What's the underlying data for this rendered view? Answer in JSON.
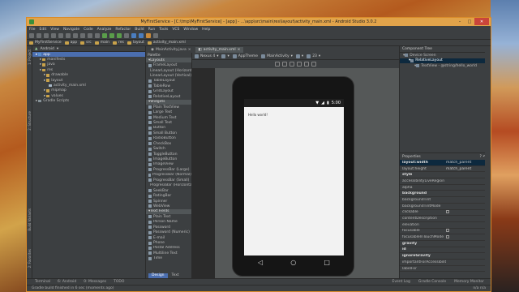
{
  "title": "MyFirstService - [C:\\tmp\\MyFirstService] - [app] - ...\\app\\src\\main\\res\\layout\\activity_main.xml - Android Studio 3.0.2",
  "menu": [
    "File",
    "Edit",
    "View",
    "Navigate",
    "Code",
    "Analyze",
    "Refactor",
    "Build",
    "Run",
    "Tools",
    "VCS",
    "Window",
    "Help"
  ],
  "breadcrumbs": [
    "MyFirstService",
    "app",
    "src",
    "main",
    "res",
    "layout",
    "activity_main.xml"
  ],
  "project": {
    "view": "Android",
    "items": [
      {
        "label": "app",
        "depth": 0,
        "type": "m",
        "sel": true
      },
      {
        "label": "manifests",
        "depth": 1,
        "type": "f"
      },
      {
        "label": "java",
        "depth": 1,
        "type": "f"
      },
      {
        "label": "res",
        "depth": 1,
        "type": "f"
      },
      {
        "label": "drawable",
        "depth": 2,
        "type": "f"
      },
      {
        "label": "layout",
        "depth": 2,
        "type": "f"
      },
      {
        "label": "activity_main.xml",
        "depth": 3,
        "type": "x"
      },
      {
        "label": "mipmap",
        "depth": 2,
        "type": "f"
      },
      {
        "label": "values",
        "depth": 2,
        "type": "f"
      },
      {
        "label": "Gradle Scripts",
        "depth": 0,
        "type": "g"
      }
    ]
  },
  "tabs": [
    {
      "label": "MainActivity.java",
      "active": false
    },
    {
      "label": "activity_main.xml",
      "active": true
    }
  ],
  "palette": {
    "header": "Palette",
    "items": [
      {
        "label": "Layouts",
        "grp": true
      },
      {
        "label": "FrameLayout"
      },
      {
        "label": "LinearLayout (Horizontal)"
      },
      {
        "label": "LinearLayout (Vertical)"
      },
      {
        "label": "TableLayout"
      },
      {
        "label": "TableRow"
      },
      {
        "label": "GridLayout"
      },
      {
        "label": "RelativeLayout"
      },
      {
        "label": "Widgets",
        "grp": true
      },
      {
        "label": "Plain TextView"
      },
      {
        "label": "Large Text"
      },
      {
        "label": "Medium Text"
      },
      {
        "label": "Small Text"
      },
      {
        "label": "Button"
      },
      {
        "label": "Small Button"
      },
      {
        "label": "RadioButton"
      },
      {
        "label": "CheckBox"
      },
      {
        "label": "Switch"
      },
      {
        "label": "ToggleButton"
      },
      {
        "label": "ImageButton"
      },
      {
        "label": "ImageView"
      },
      {
        "label": "ProgressBar (Large)"
      },
      {
        "label": "ProgressBar (Normal)"
      },
      {
        "label": "ProgressBar (Small)"
      },
      {
        "label": "ProgressBar (Horizontal)"
      },
      {
        "label": "SeekBar"
      },
      {
        "label": "RatingBar"
      },
      {
        "label": "Spinner"
      },
      {
        "label": "WebView"
      },
      {
        "label": "Text Fields",
        "grp": true
      },
      {
        "label": "Plain Text"
      },
      {
        "label": "Person Name"
      },
      {
        "label": "Password"
      },
      {
        "label": "Password (Numeric)"
      },
      {
        "label": "E-mail"
      },
      {
        "label": "Phone"
      },
      {
        "label": "Postal Address"
      },
      {
        "label": "Multiline Text"
      },
      {
        "label": "Time"
      }
    ],
    "tabs": [
      "Design",
      "Text"
    ]
  },
  "designbar": [
    "Nexus 4",
    "AppTheme",
    "MainActivity",
    "23"
  ],
  "phone": {
    "time": "5:00",
    "hello": "Hello world!"
  },
  "component_tree": {
    "header": "Component Tree",
    "items": [
      {
        "label": "Device Screen",
        "depth": 0
      },
      {
        "label": "RelativeLayout",
        "depth": 1,
        "sel": true
      },
      {
        "label": "TextView - @string/hello_world",
        "depth": 2
      }
    ]
  },
  "properties": {
    "header": "Properties",
    "rows": [
      {
        "k": "layout:width",
        "v": "match_parent",
        "b": true,
        "sel": true
      },
      {
        "k": "layout:height",
        "v": "match_parent"
      },
      {
        "k": "style",
        "v": "",
        "b": true
      },
      {
        "k": "accessibilityLiveRegion",
        "v": ""
      },
      {
        "k": "alpha",
        "v": ""
      },
      {
        "k": "background",
        "v": "",
        "b": true
      },
      {
        "k": "backgroundTint",
        "v": ""
      },
      {
        "k": "backgroundTintMode",
        "v": ""
      },
      {
        "k": "clickable",
        "v": "chk"
      },
      {
        "k": "contentDescription",
        "v": ""
      },
      {
        "k": "elevation",
        "v": ""
      },
      {
        "k": "focusable",
        "v": "chk"
      },
      {
        "k": "focusableInTouchMode",
        "v": "chk"
      },
      {
        "k": "gravity",
        "v": "",
        "b": true
      },
      {
        "k": "id",
        "v": "",
        "b": true
      },
      {
        "k": "ignoreGravity",
        "v": "",
        "b": true
      },
      {
        "k": "importantForAccessibility",
        "v": ""
      },
      {
        "k": "labelFor",
        "v": ""
      }
    ]
  },
  "bottom_tabs": {
    "left": [
      "Terminal",
      "6: Android",
      "0: Messages",
      "TODO"
    ],
    "right": [
      "Event Log",
      "Gradle Console",
      "Memory Monitor"
    ]
  },
  "status": {
    "text": "Gradle build finished in 6 sec (moments ago)",
    "right": "n/a   n/a"
  },
  "side_tabs": {
    "left": [
      "1: Project",
      "2: Structure",
      "Build Variants",
      "2: Favorites"
    ],
    "right": [
      "Gradle",
      "Maven Projects"
    ]
  }
}
